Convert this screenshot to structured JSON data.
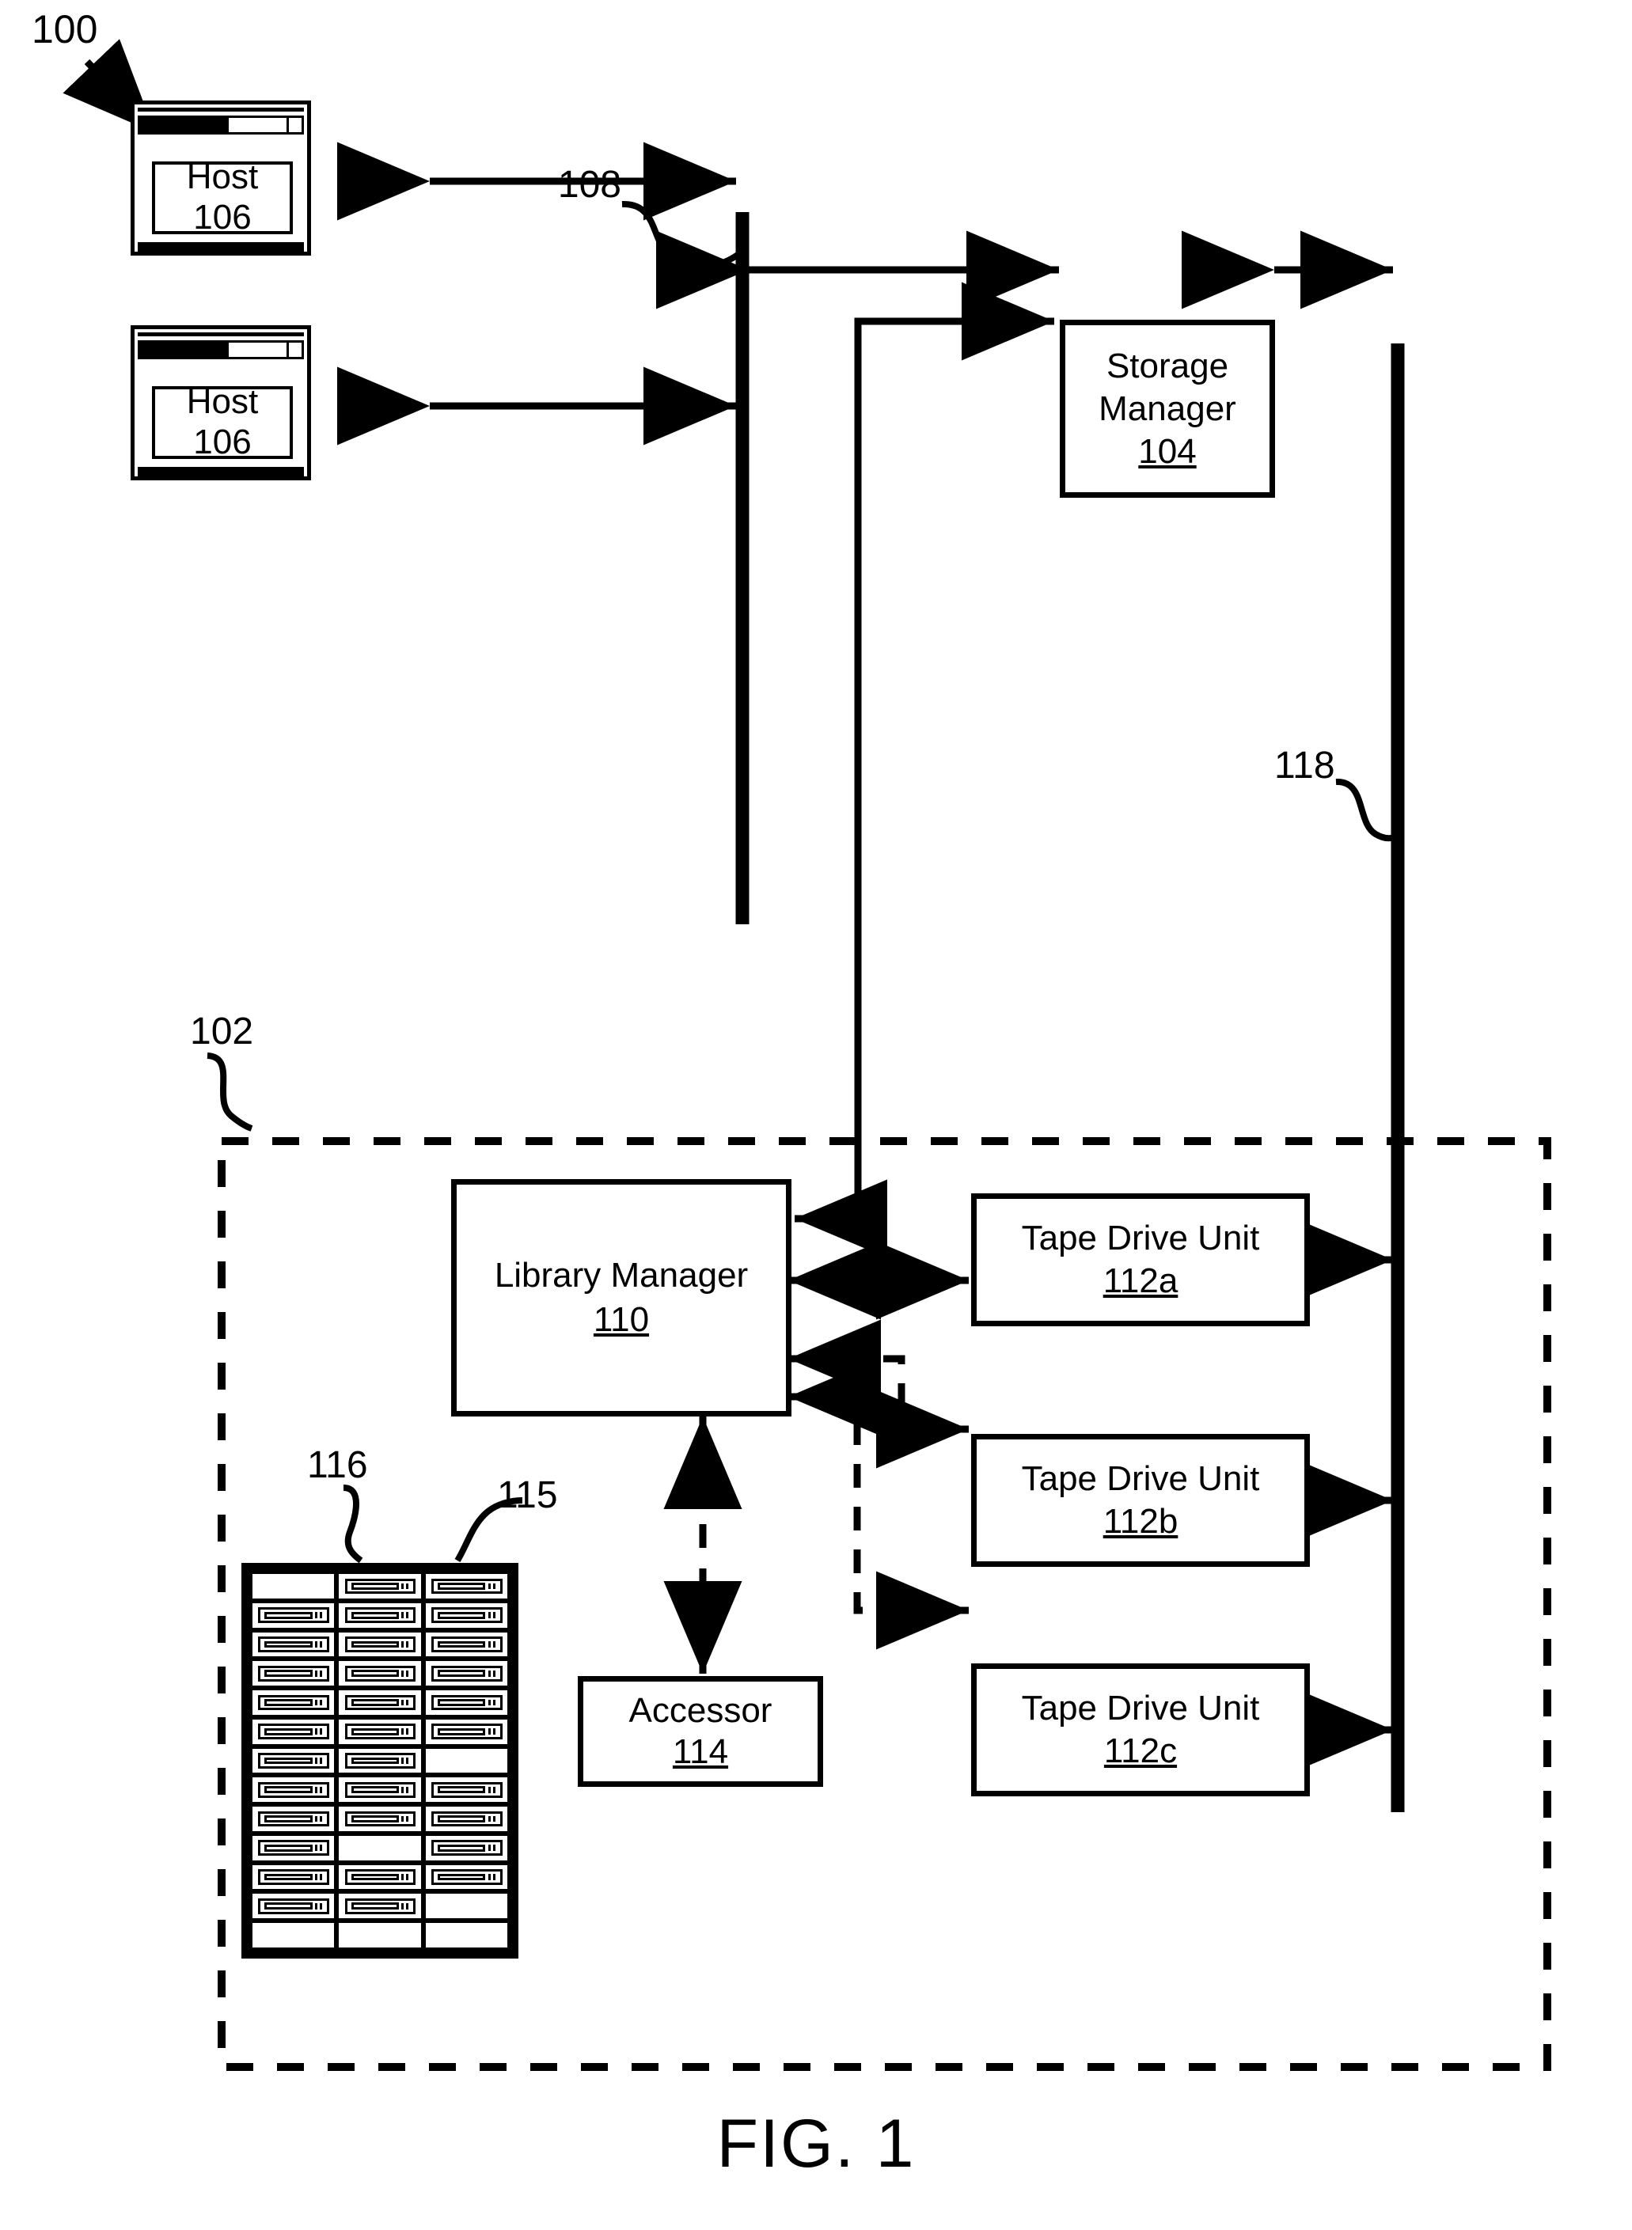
{
  "figure": {
    "caption": "FIG. 1",
    "system_ref": "100"
  },
  "references": {
    "system": "100",
    "library": "102",
    "storage_manager": "104",
    "host": "106",
    "host_bus": "108",
    "library_manager": "110",
    "tape_drive_a": "112a",
    "tape_drive_b": "112b",
    "tape_drive_c": "112c",
    "accessor": "114",
    "cartridge": "115",
    "magazine": "116",
    "drive_bus": "118"
  },
  "nodes": {
    "host1": {
      "title": "Host",
      "ref": "106"
    },
    "host2": {
      "title": "Host",
      "ref": "106"
    },
    "storage_manager": {
      "title_line1": "Storage",
      "title_line2": "Manager",
      "ref": "104"
    },
    "library_manager": {
      "title": "Library Manager",
      "ref": "110"
    },
    "accessor": {
      "title": "Accessor",
      "ref": "114"
    },
    "tape_drives": [
      {
        "title": "Tape Drive Unit",
        "ref": "112a"
      },
      {
        "title": "Tape Drive Unit",
        "ref": "112b"
      },
      {
        "title": "Tape Drive Unit",
        "ref": "112c"
      }
    ]
  },
  "labels": {
    "system_100": "100",
    "bus_108": "108",
    "bus_118": "118",
    "library_102": "102",
    "magazine_116": "116",
    "cartridge_115": "115"
  },
  "magazine": {
    "rows": 13,
    "columns": 3,
    "occupied": [
      [
        false,
        true,
        true
      ],
      [
        true,
        true,
        true
      ],
      [
        true,
        true,
        true
      ],
      [
        true,
        true,
        true
      ],
      [
        true,
        true,
        true
      ],
      [
        true,
        true,
        true
      ],
      [
        true,
        true,
        false
      ],
      [
        true,
        true,
        true
      ],
      [
        true,
        true,
        true
      ],
      [
        true,
        false,
        true
      ],
      [
        true,
        true,
        true
      ],
      [
        true,
        true,
        false
      ],
      [
        false,
        false,
        false
      ]
    ]
  },
  "colors": {
    "line": "#000000",
    "background": "#ffffff"
  }
}
